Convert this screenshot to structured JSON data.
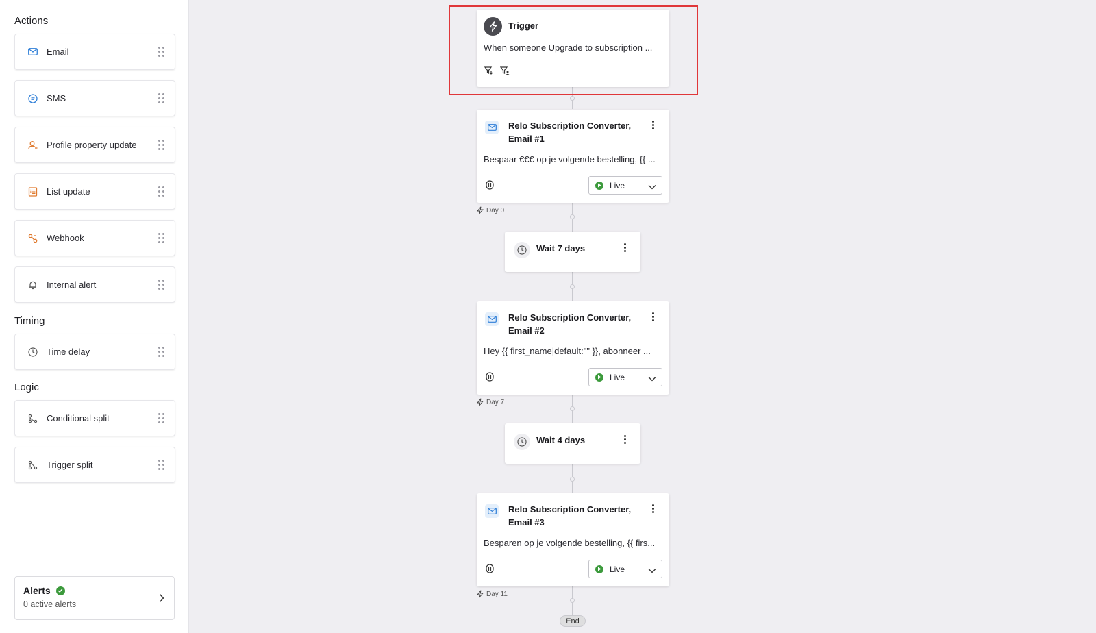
{
  "sidebar": {
    "sections": {
      "actions": "Actions",
      "timing": "Timing",
      "logic": "Logic"
    },
    "actions": [
      {
        "label": "Email",
        "icon": "mail-icon",
        "color": "#2f7fd8"
      },
      {
        "label": "SMS",
        "icon": "sms-icon",
        "color": "#2f7fd8"
      },
      {
        "label": "Profile property update",
        "icon": "profile-icon",
        "color": "#e07a2e"
      },
      {
        "label": "List update",
        "icon": "list-icon",
        "color": "#e07a2e"
      },
      {
        "label": "Webhook",
        "icon": "webhook-icon",
        "color": "#e07a2e"
      },
      {
        "label": "Internal alert",
        "icon": "bell-icon",
        "color": "#555555"
      }
    ],
    "timing": [
      {
        "label": "Time delay",
        "icon": "clock-icon"
      }
    ],
    "logic": [
      {
        "label": "Conditional split",
        "icon": "conditional-split-icon"
      },
      {
        "label": "Trigger split",
        "icon": "trigger-split-icon"
      }
    ],
    "alerts": {
      "title": "Alerts",
      "subtitle": "0 active alerts"
    }
  },
  "flow": {
    "trigger": {
      "title": "Trigger",
      "description": "When someone Upgrade to subscription ..."
    },
    "emails": [
      {
        "title_line1": "Relo Subscription Converter,",
        "title_line2": "Email #1",
        "preview": "Bespaar €€€ op je volgende bestelling, {{ ...",
        "status": "Live",
        "day": "Day 0"
      },
      {
        "title_line1": "Relo Subscription Converter,",
        "title_line2": "Email #2",
        "preview": "Hey {{ first_name|default:\"\" }}, abonneer ...",
        "status": "Live",
        "day": "Day 7"
      },
      {
        "title_line1": "Relo Subscription Converter,",
        "title_line2": "Email #3",
        "preview": "Besparen op je volgende bestelling, {{ firs...",
        "status": "Live",
        "day": "Day 11"
      }
    ],
    "waits": [
      {
        "label": "Wait 7 days"
      },
      {
        "label": "Wait 4 days"
      }
    ],
    "end": "End"
  },
  "colors": {
    "highlight": "#e0373a",
    "live": "#3c9a3c",
    "email_accent": "#2f7fd8"
  }
}
